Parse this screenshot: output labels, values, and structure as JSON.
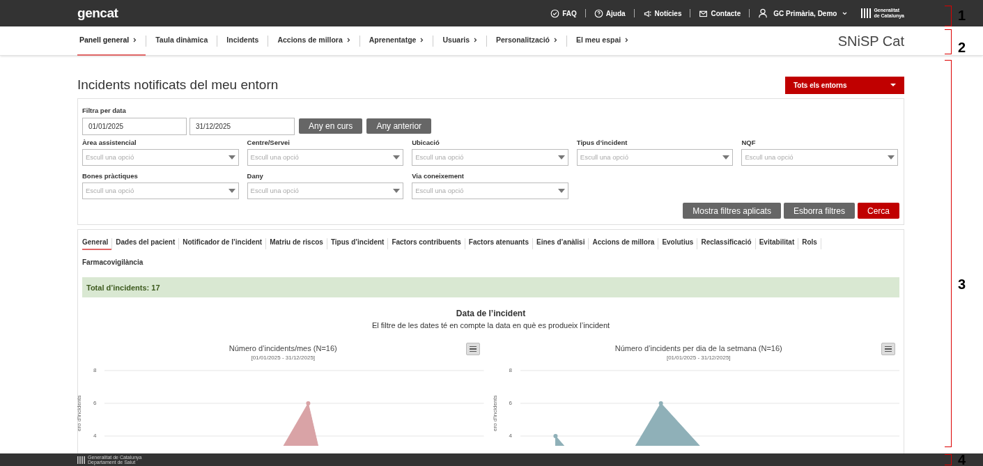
{
  "topbar": {
    "logo": "gencat",
    "links": [
      {
        "kind": "faq",
        "label": "FAQ"
      },
      {
        "kind": "help",
        "label": "Ajuda"
      },
      {
        "kind": "news",
        "label": "Notícies"
      },
      {
        "kind": "mail",
        "label": "Contacte"
      }
    ],
    "user": "GC Primària, Demo",
    "brand": [
      "Generalitat",
      "de Catalunya"
    ]
  },
  "nav": {
    "items": [
      {
        "label": "Panell general",
        "submenu": true,
        "selected": true
      },
      {
        "label": "Taula dinàmica",
        "submenu": false,
        "selected": false
      },
      {
        "label": "Incidents",
        "submenu": false,
        "selected": false
      },
      {
        "label": "Accions de millora",
        "submenu": true,
        "selected": false
      },
      {
        "label": "Aprenentatge",
        "submenu": true,
        "selected": false
      },
      {
        "label": "Usuaris",
        "submenu": true,
        "selected": false
      },
      {
        "label": "Personalització",
        "submenu": true,
        "selected": false
      },
      {
        "label": "El meu espai",
        "submenu": true,
        "selected": false
      }
    ],
    "app_name": "SNiSP Cat"
  },
  "page": {
    "title": "Incidents notificats del meu entorn",
    "scope_dropdown": "Tots els entorns"
  },
  "filters": {
    "date_label": "Filtra per data",
    "date_from": "01/01/2025",
    "date_to": "31/12/2025",
    "date_buttons": [
      "Any en curs",
      "Any anterior"
    ],
    "selects": [
      {
        "label": "Àrea assistencial",
        "placeholder": "Escull una opció"
      },
      {
        "label": "Centre/Servei",
        "placeholder": "Escull una opció"
      },
      {
        "label": "Ubicació",
        "placeholder": "Escull una opció"
      },
      {
        "label": "Tipus d’incident",
        "placeholder": "Escull una opció"
      },
      {
        "label": "NQF",
        "placeholder": "Escull una opció"
      },
      {
        "label": "Bones pràctiques",
        "placeholder": "Escull una opció"
      },
      {
        "label": "Dany",
        "placeholder": "Escull una opció"
      },
      {
        "label": "Via coneixement",
        "placeholder": "Escull una opció"
      }
    ],
    "actions": [
      {
        "kind": "secondary",
        "label": "Mostra filtres aplicats"
      },
      {
        "kind": "secondary",
        "label": "Esborra filtres"
      },
      {
        "kind": "primary",
        "label": "Cerca"
      }
    ]
  },
  "tabs": [
    {
      "label": "General",
      "selected": true
    },
    {
      "label": "Dades del pacient",
      "selected": false
    },
    {
      "label": "Notificador de l’incident",
      "selected": false
    },
    {
      "label": "Matriu de riscos",
      "selected": false
    },
    {
      "label": "Tipus d’incident",
      "selected": false
    },
    {
      "label": "Factors contribuents",
      "selected": false
    },
    {
      "label": "Factors atenuants",
      "selected": false
    },
    {
      "label": "Eines d’anàlisi",
      "selected": false
    },
    {
      "label": "Accions de millora",
      "selected": false
    },
    {
      "label": "Evolutius",
      "selected": false
    },
    {
      "label": "Reclassificació",
      "selected": false
    },
    {
      "label": "Evitabilitat",
      "selected": false
    },
    {
      "label": "Rols",
      "selected": false
    },
    {
      "label": "Farmacovigilància",
      "selected": false
    }
  ],
  "total": "Total d’incidents: 17",
  "section": {
    "title": "Data de l’incident",
    "subtitle": "El filtre de les dates té en compte la data en què es produeix l’incident"
  },
  "charts": [
    {
      "title": "Número d’incidents/mes (N=16)",
      "range": "[01/01/2025 - 31/12/2025]",
      "y_ticks": [
        "8",
        "6",
        "4"
      ],
      "ylabel": "ero d’incidents",
      "color": "#d9a3a6"
    },
    {
      "title": "Número d’incidents per dia de la setmana (N=16)",
      "range": "[01/01/2025 - 31/12/2025]",
      "y_ticks": [
        "8",
        "6",
        "4"
      ],
      "ylabel": "ero d’incidents",
      "color": "#8fb0b8"
    }
  ],
  "footer": [
    "Generalitat de Catalunya",
    "Departament de Salut"
  ],
  "callouts": [
    "1",
    "2",
    "3",
    "4"
  ]
}
